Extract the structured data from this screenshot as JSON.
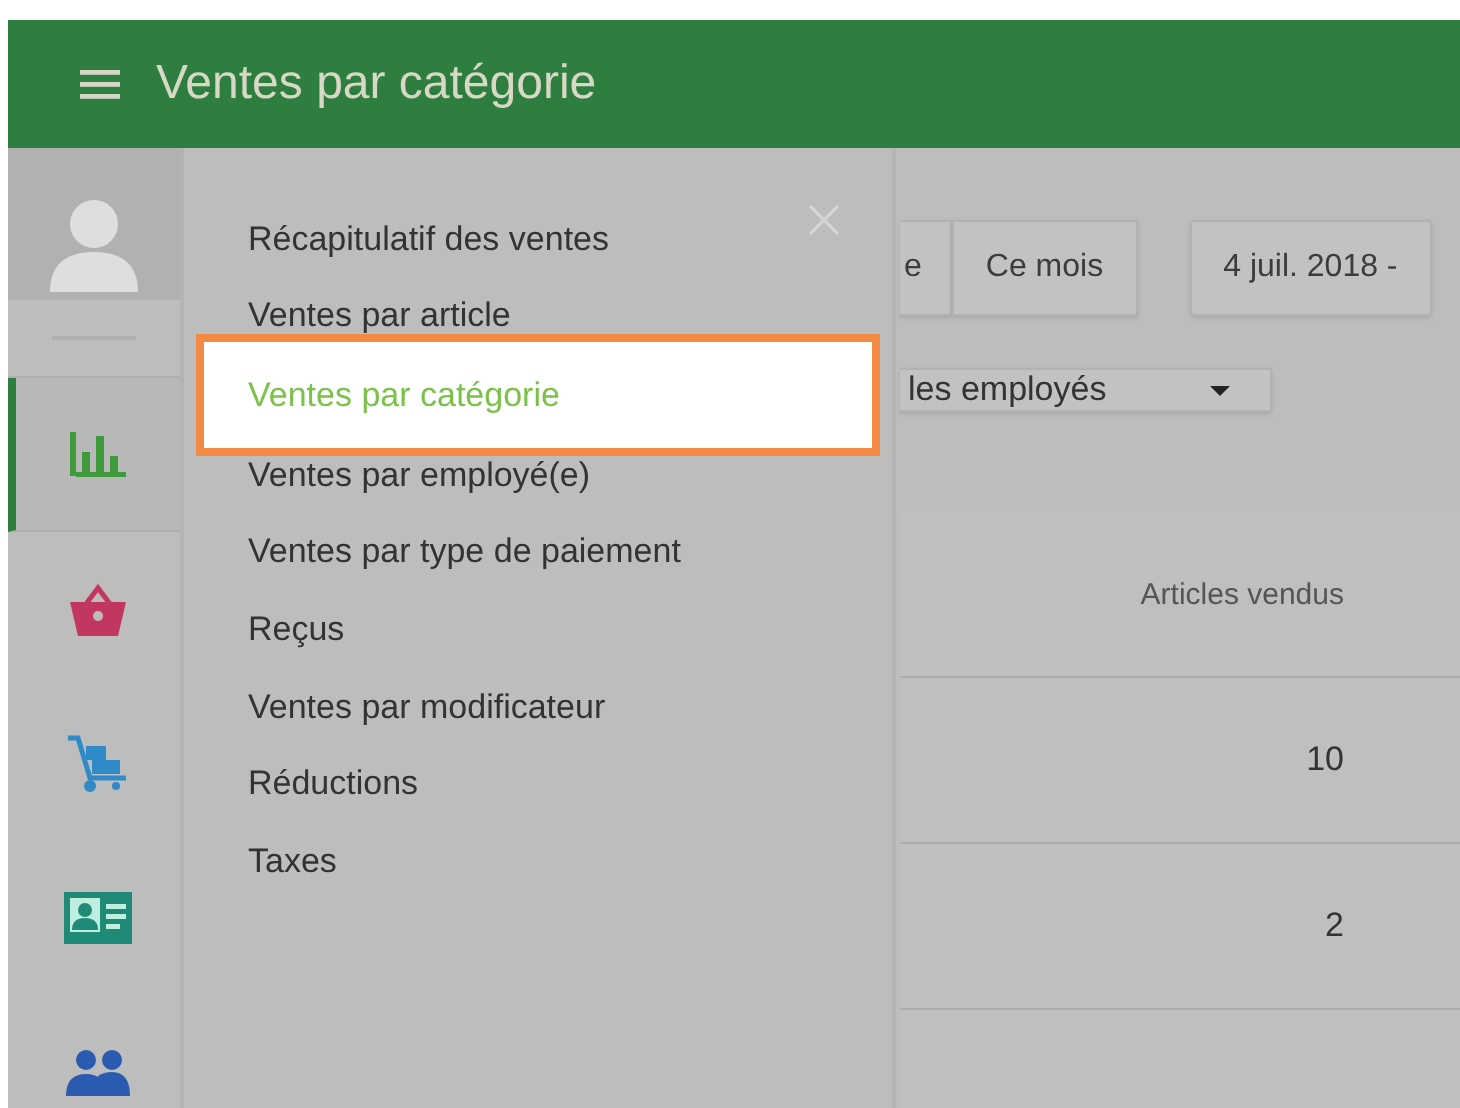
{
  "header": {
    "title": "Ventes par catégorie"
  },
  "sidebar": {
    "items": [
      {
        "kind": "chart",
        "selected": true
      },
      {
        "kind": "basket",
        "selected": false
      },
      {
        "kind": "cart",
        "selected": false
      },
      {
        "kind": "card",
        "selected": false
      },
      {
        "kind": "people",
        "selected": false
      }
    ]
  },
  "menu": {
    "items": [
      {
        "label": "Récapitulatif des ventes",
        "selected": false
      },
      {
        "label": "Ventes par article",
        "selected": false
      },
      {
        "label": "Ventes par catégorie",
        "selected": true
      },
      {
        "label": "Ventes par employé(e)",
        "selected": false
      },
      {
        "label": "Ventes par type de paiement",
        "selected": false
      },
      {
        "label": "Reçus",
        "selected": false
      },
      {
        "label": "Ventes par modificateur",
        "selected": false
      },
      {
        "label": "Réductions",
        "selected": false
      },
      {
        "label": "Taxes",
        "selected": false
      }
    ]
  },
  "filters": {
    "period_buttons": [
      "e",
      "Ce mois"
    ],
    "date_range": "4 juil. 2018 -",
    "employee_dropdown": "les employés"
  },
  "table": {
    "columns": [
      "Articles vendus"
    ],
    "rows": [
      [
        "10"
      ],
      [
        "2"
      ]
    ]
  }
}
